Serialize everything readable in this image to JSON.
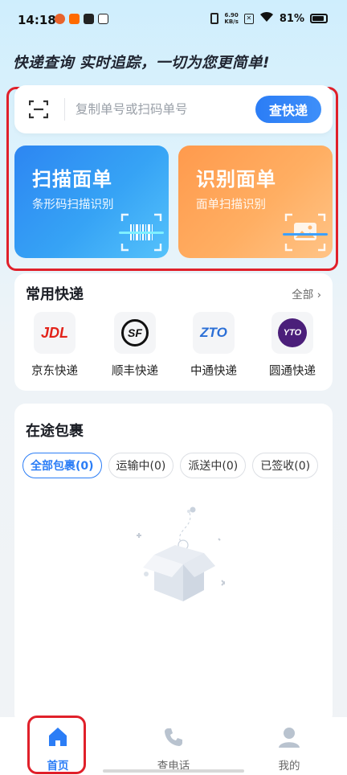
{
  "status_bar": {
    "time": "14:18",
    "net_speed_value": "6.90",
    "net_speed_unit": "KB/s",
    "battery": "81%",
    "app_icons": [
      "weibo-icon",
      "taobao-icon",
      "video-icon",
      "play-store-icon"
    ]
  },
  "slogan": "快递查询 实时追踪，一切为您更简单!",
  "search": {
    "placeholder": "复制单号或扫码单号",
    "value": "",
    "button_label": "查快递",
    "scan_icon": "scan-icon"
  },
  "feature_cards": [
    {
      "title": "扫描面单",
      "subtitle": "条形码扫描识别",
      "icon": "barcode-scan-icon"
    },
    {
      "title": "识别面单",
      "subtitle": "面单扫描识别",
      "icon": "image-scan-icon"
    }
  ],
  "couriers": {
    "title": "常用快递",
    "more_label": "全部",
    "items": [
      {
        "name": "京东快递",
        "logo_text": "JDL",
        "color": "#e2231a"
      },
      {
        "name": "顺丰快递",
        "logo_text": "SF",
        "color": "#111111"
      },
      {
        "name": "中通快递",
        "logo_text": "ZTO",
        "color": "#2b6fd6"
      },
      {
        "name": "圆通快递",
        "logo_text": "YTO",
        "color": "#4b1f7a"
      }
    ]
  },
  "parcels": {
    "title": "在途包裹",
    "tabs": [
      {
        "label": "全部包裹(0)",
        "active": true
      },
      {
        "label": "运输中(0)",
        "active": false
      },
      {
        "label": "派送中(0)",
        "active": false
      },
      {
        "label": "已签收(0)",
        "active": false
      }
    ]
  },
  "bottom_nav": [
    {
      "label": "首页",
      "icon": "home-icon",
      "active": true
    },
    {
      "label": "查电话",
      "icon": "phone-icon",
      "active": false
    },
    {
      "label": "我的",
      "icon": "user-icon",
      "active": false
    }
  ],
  "colors": {
    "accent": "#2b7df6",
    "highlight_frame": "#e0202a",
    "scan_card": "#2d86f2",
    "identify_card": "#ff9a4d"
  }
}
